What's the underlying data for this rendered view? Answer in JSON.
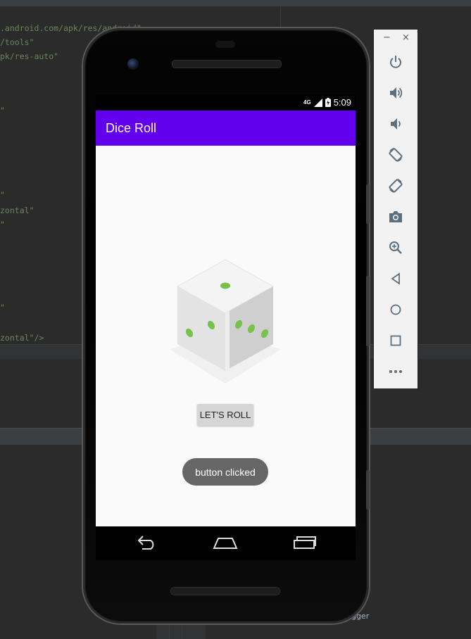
{
  "ide": {
    "code_lines": [
      ".android.com/apk/res/android\"",
      "/tools\"",
      "pk/res-auto\"",
      "\"",
      "\"",
      "zontal\"",
      "\"",
      "\"",
      "zontal\"/>"
    ],
    "debugger_tab": "ugger"
  },
  "phone": {
    "status_bar": {
      "network": "4G",
      "time": "5:09"
    },
    "app": {
      "title": "Dice Roll",
      "roll_button_label": "LET'S ROLL",
      "toast_message": "button clicked",
      "dice_image": "dice-image",
      "accent_color": "#6200ee"
    },
    "navigation": {
      "back": "back-icon",
      "home": "home-icon",
      "recents": "recents-icon"
    }
  },
  "emulator_toolbar": {
    "window_controls": {
      "minimize": "−",
      "close": "×"
    },
    "tools": [
      "power-icon",
      "volume-up-icon",
      "volume-down-icon",
      "rotate-left-icon",
      "rotate-right-icon",
      "camera-icon",
      "zoom-icon",
      "back-icon",
      "home-icon",
      "overview-icon",
      "more-icon"
    ]
  }
}
